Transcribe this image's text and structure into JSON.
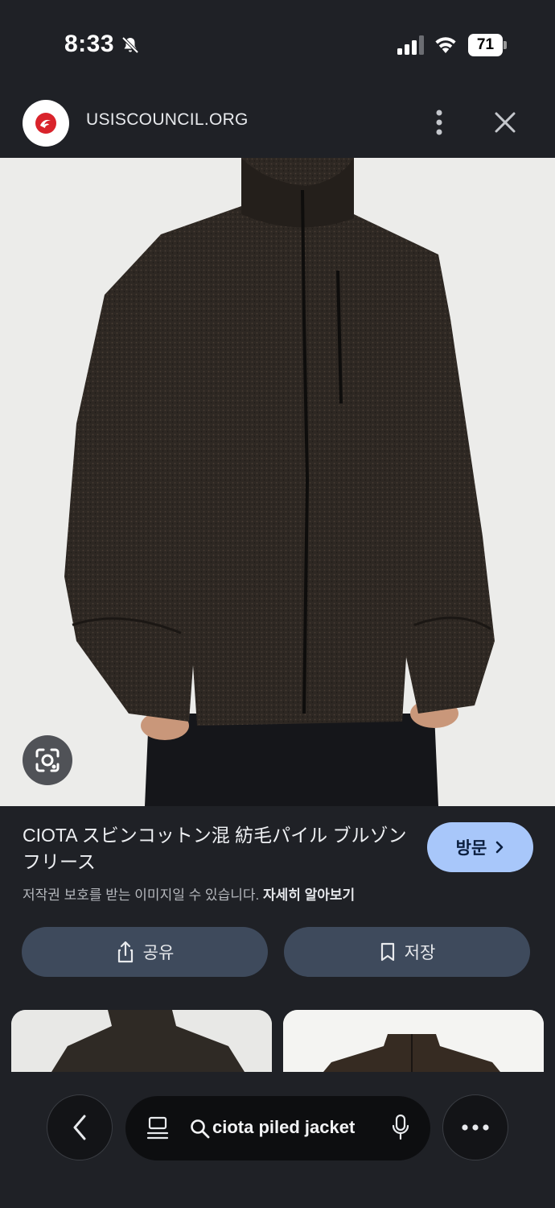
{
  "status_bar": {
    "time": "8:33",
    "battery": "71",
    "icons": [
      "bell-slash-icon",
      "cellular-signal-icon",
      "wifi-icon",
      "battery-icon"
    ]
  },
  "header": {
    "domain": "USISCOUNCIL.ORG",
    "icons": [
      "site-favicon",
      "more-vertical-icon",
      "close-icon"
    ]
  },
  "result": {
    "title": "CIOTA スビンコットン混 紡毛パイル ブルゾン フリース",
    "copyright_notice": "저작권 보호를 받는 이미지일 수 있습니다.",
    "learn_more": "자세히 알아보기",
    "visit_label": "방문",
    "share_label": "공유",
    "save_label": "저장"
  },
  "bottom_bar": {
    "query": "ciota piled jacket",
    "icons": [
      "chevron-left-icon",
      "tabs-icon",
      "search-icon",
      "microphone-icon",
      "more-horizontal-icon"
    ]
  },
  "colors": {
    "background": "#1f2126",
    "visit_button": "#a8c7fa",
    "action_button": "#3e4a5c",
    "jacket": "#2c2622"
  }
}
